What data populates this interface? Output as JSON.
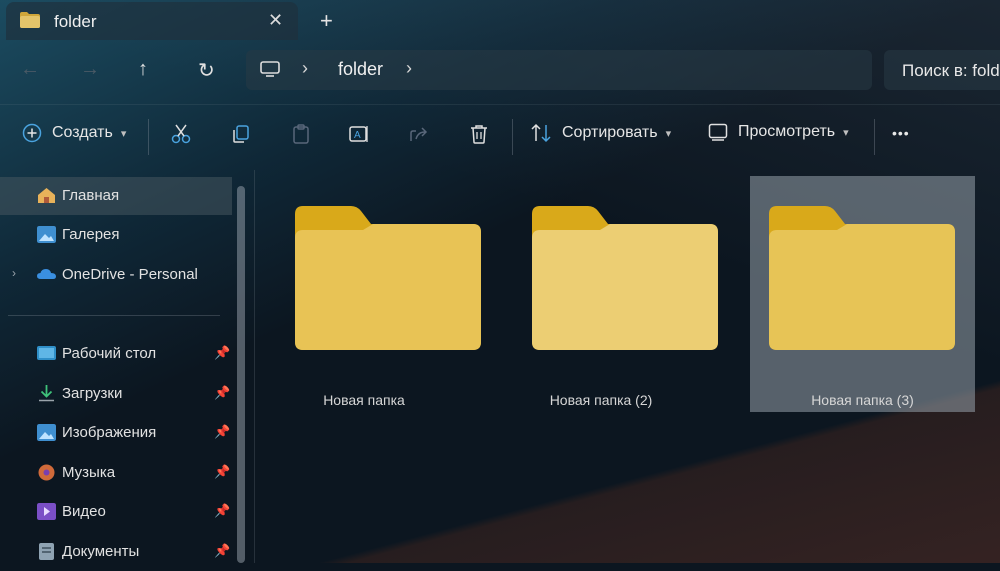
{
  "tab": {
    "title": "folder",
    "close": "✕",
    "new": "+"
  },
  "nav": {
    "back": "←",
    "forward": "→",
    "up": "↑",
    "refresh": "↻"
  },
  "address": {
    "chevron": "›",
    "folder": "folder"
  },
  "search": {
    "placeholder": "Поиск в: folder"
  },
  "toolbar": {
    "new_label": "Создать",
    "sort_label": "Сортировать",
    "view_label": "Просмотреть",
    "more": "•••"
  },
  "sidebar": {
    "items": [
      {
        "label": "Главная",
        "icon": "home-icon"
      },
      {
        "label": "Галерея",
        "icon": "gallery-icon"
      },
      {
        "label": "OneDrive - Personal",
        "icon": "onedrive-icon"
      },
      {
        "label": "Рабочий стол",
        "icon": "desktop-icon"
      },
      {
        "label": "Загрузки",
        "icon": "downloads-icon"
      },
      {
        "label": "Изображения",
        "icon": "pictures-icon"
      },
      {
        "label": "Музыка",
        "icon": "music-icon"
      },
      {
        "label": "Видео",
        "icon": "video-icon"
      },
      {
        "label": "Документы",
        "icon": "documents-icon"
      }
    ]
  },
  "folders": [
    {
      "name": "Новая папка",
      "selected": false
    },
    {
      "name": "Новая папка (2)",
      "selected": false
    },
    {
      "name": "Новая папка (3)",
      "selected": true
    }
  ],
  "colors": {
    "folder_back": "#d9a91a",
    "folder_front": "#e8c55a",
    "accent": "#4aa3df"
  }
}
